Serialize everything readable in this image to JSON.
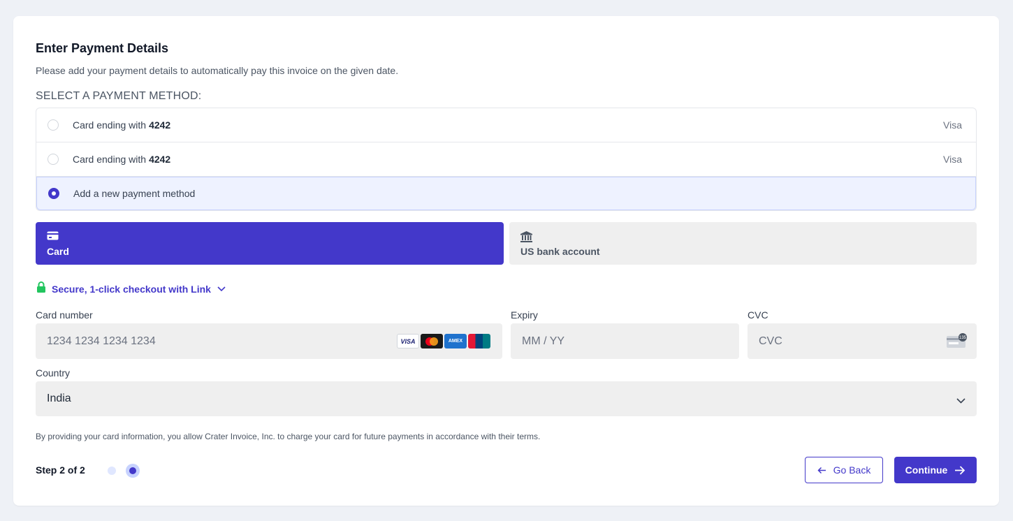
{
  "header": {
    "title": "Enter Payment Details",
    "subtitle": "Please add your payment details to automatically pay this invoice on the given date."
  },
  "payment_methods": {
    "section_label": "SELECT A PAYMENT METHOD:",
    "items": [
      {
        "prefix": "Card ending with",
        "last4": "4242",
        "brand": "Visa",
        "selected": false
      },
      {
        "prefix": "Card ending with",
        "last4": "4242",
        "brand": "Visa",
        "selected": false
      },
      {
        "label": "Add a new payment method",
        "selected": true
      }
    ]
  },
  "tabs": [
    {
      "label": "Card",
      "icon": "credit-card-icon",
      "active": true
    },
    {
      "label": "US bank account",
      "icon": "bank-icon",
      "active": false
    }
  ],
  "link": {
    "text": "Secure, 1-click checkout with Link",
    "icon": "lock-icon",
    "color": "#4338ca"
  },
  "form": {
    "card_number_label": "Card number",
    "card_number_placeholder": "1234 1234 1234 1234",
    "card_brands": [
      "VISA",
      "Mastercard",
      "AMEX",
      "UnionPay"
    ],
    "expiry_label": "Expiry",
    "expiry_placeholder": "MM / YY",
    "cvc_label": "CVC",
    "cvc_placeholder": "CVC",
    "cvc_icon_text": "135",
    "country_label": "Country",
    "country_value": "India"
  },
  "terms": "By providing your card information, you allow Crater Invoice, Inc. to charge your card for future payments in accordance with their terms.",
  "footer": {
    "step_text": "Step 2 of 2",
    "back_label": "Go Back",
    "continue_label": "Continue"
  },
  "colors": {
    "accent": "#4338ca",
    "background": "#eef1f6",
    "selected_row": "#eef2ff",
    "field_bg": "#efefef"
  }
}
